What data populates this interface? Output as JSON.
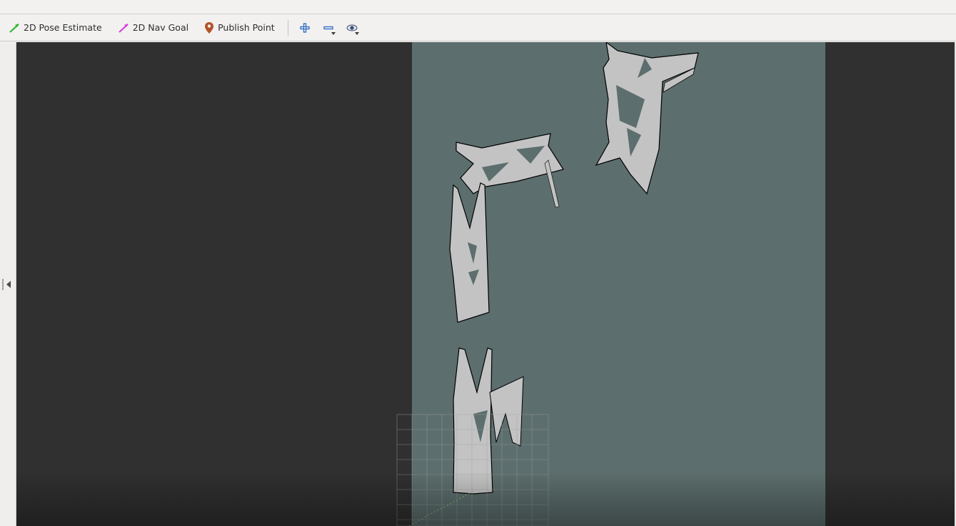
{
  "toolbar": {
    "tools": [
      {
        "label": "2D Pose Estimate",
        "icon": "green-arrow-icon",
        "color": "#2fb52f"
      },
      {
        "label": "2D Nav Goal",
        "icon": "magenta-arrow-icon",
        "color": "#d93fd9"
      },
      {
        "label": "Publish Point",
        "icon": "map-pin-icon",
        "color": "#b5532a"
      }
    ],
    "view_controls": [
      {
        "icon": "zoom-in-icon",
        "color": "#2d6bc4"
      },
      {
        "icon": "zoom-out-icon",
        "color": "#2d6bc4"
      },
      {
        "icon": "eye-icon",
        "color": "#3b4a70"
      }
    ]
  },
  "viewport": {
    "background_color": "#303030",
    "map_unknown_color": "#5c6e6d",
    "map_free_color": "#c3c3c3",
    "map_occupied_color": "#000000",
    "grid_color": "#a0a0a0",
    "grid_visible": true
  }
}
